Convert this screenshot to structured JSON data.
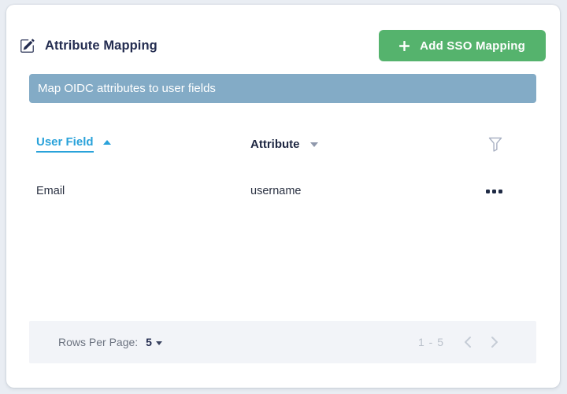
{
  "card": {
    "header": {
      "title": "Attribute Mapping",
      "edit_icon": "pencil-square-icon",
      "add_button": {
        "label": "Add SSO Mapping",
        "icon": "plus-icon",
        "color": "#55b36d"
      }
    },
    "banner": {
      "text": "Map OIDC attributes to user fields",
      "color": "#83abc6"
    },
    "table": {
      "columns": [
        {
          "label": "User Field",
          "sort": "asc",
          "active": true,
          "color": "#29a2da"
        },
        {
          "label": "Attribute",
          "sort": "desc",
          "active": false
        }
      ],
      "filter_icon": "funnel-icon",
      "rows": [
        {
          "user_field": "Email",
          "attribute": "username",
          "actions_icon": "ellipsis-icon"
        }
      ]
    },
    "footer": {
      "rows_per_page_label": "Rows Per Page:",
      "rows_per_page_value": "5",
      "range_label": "1 - 5",
      "prev_icon": "chevron-left-icon",
      "next_icon": "chevron-right-icon"
    }
  }
}
